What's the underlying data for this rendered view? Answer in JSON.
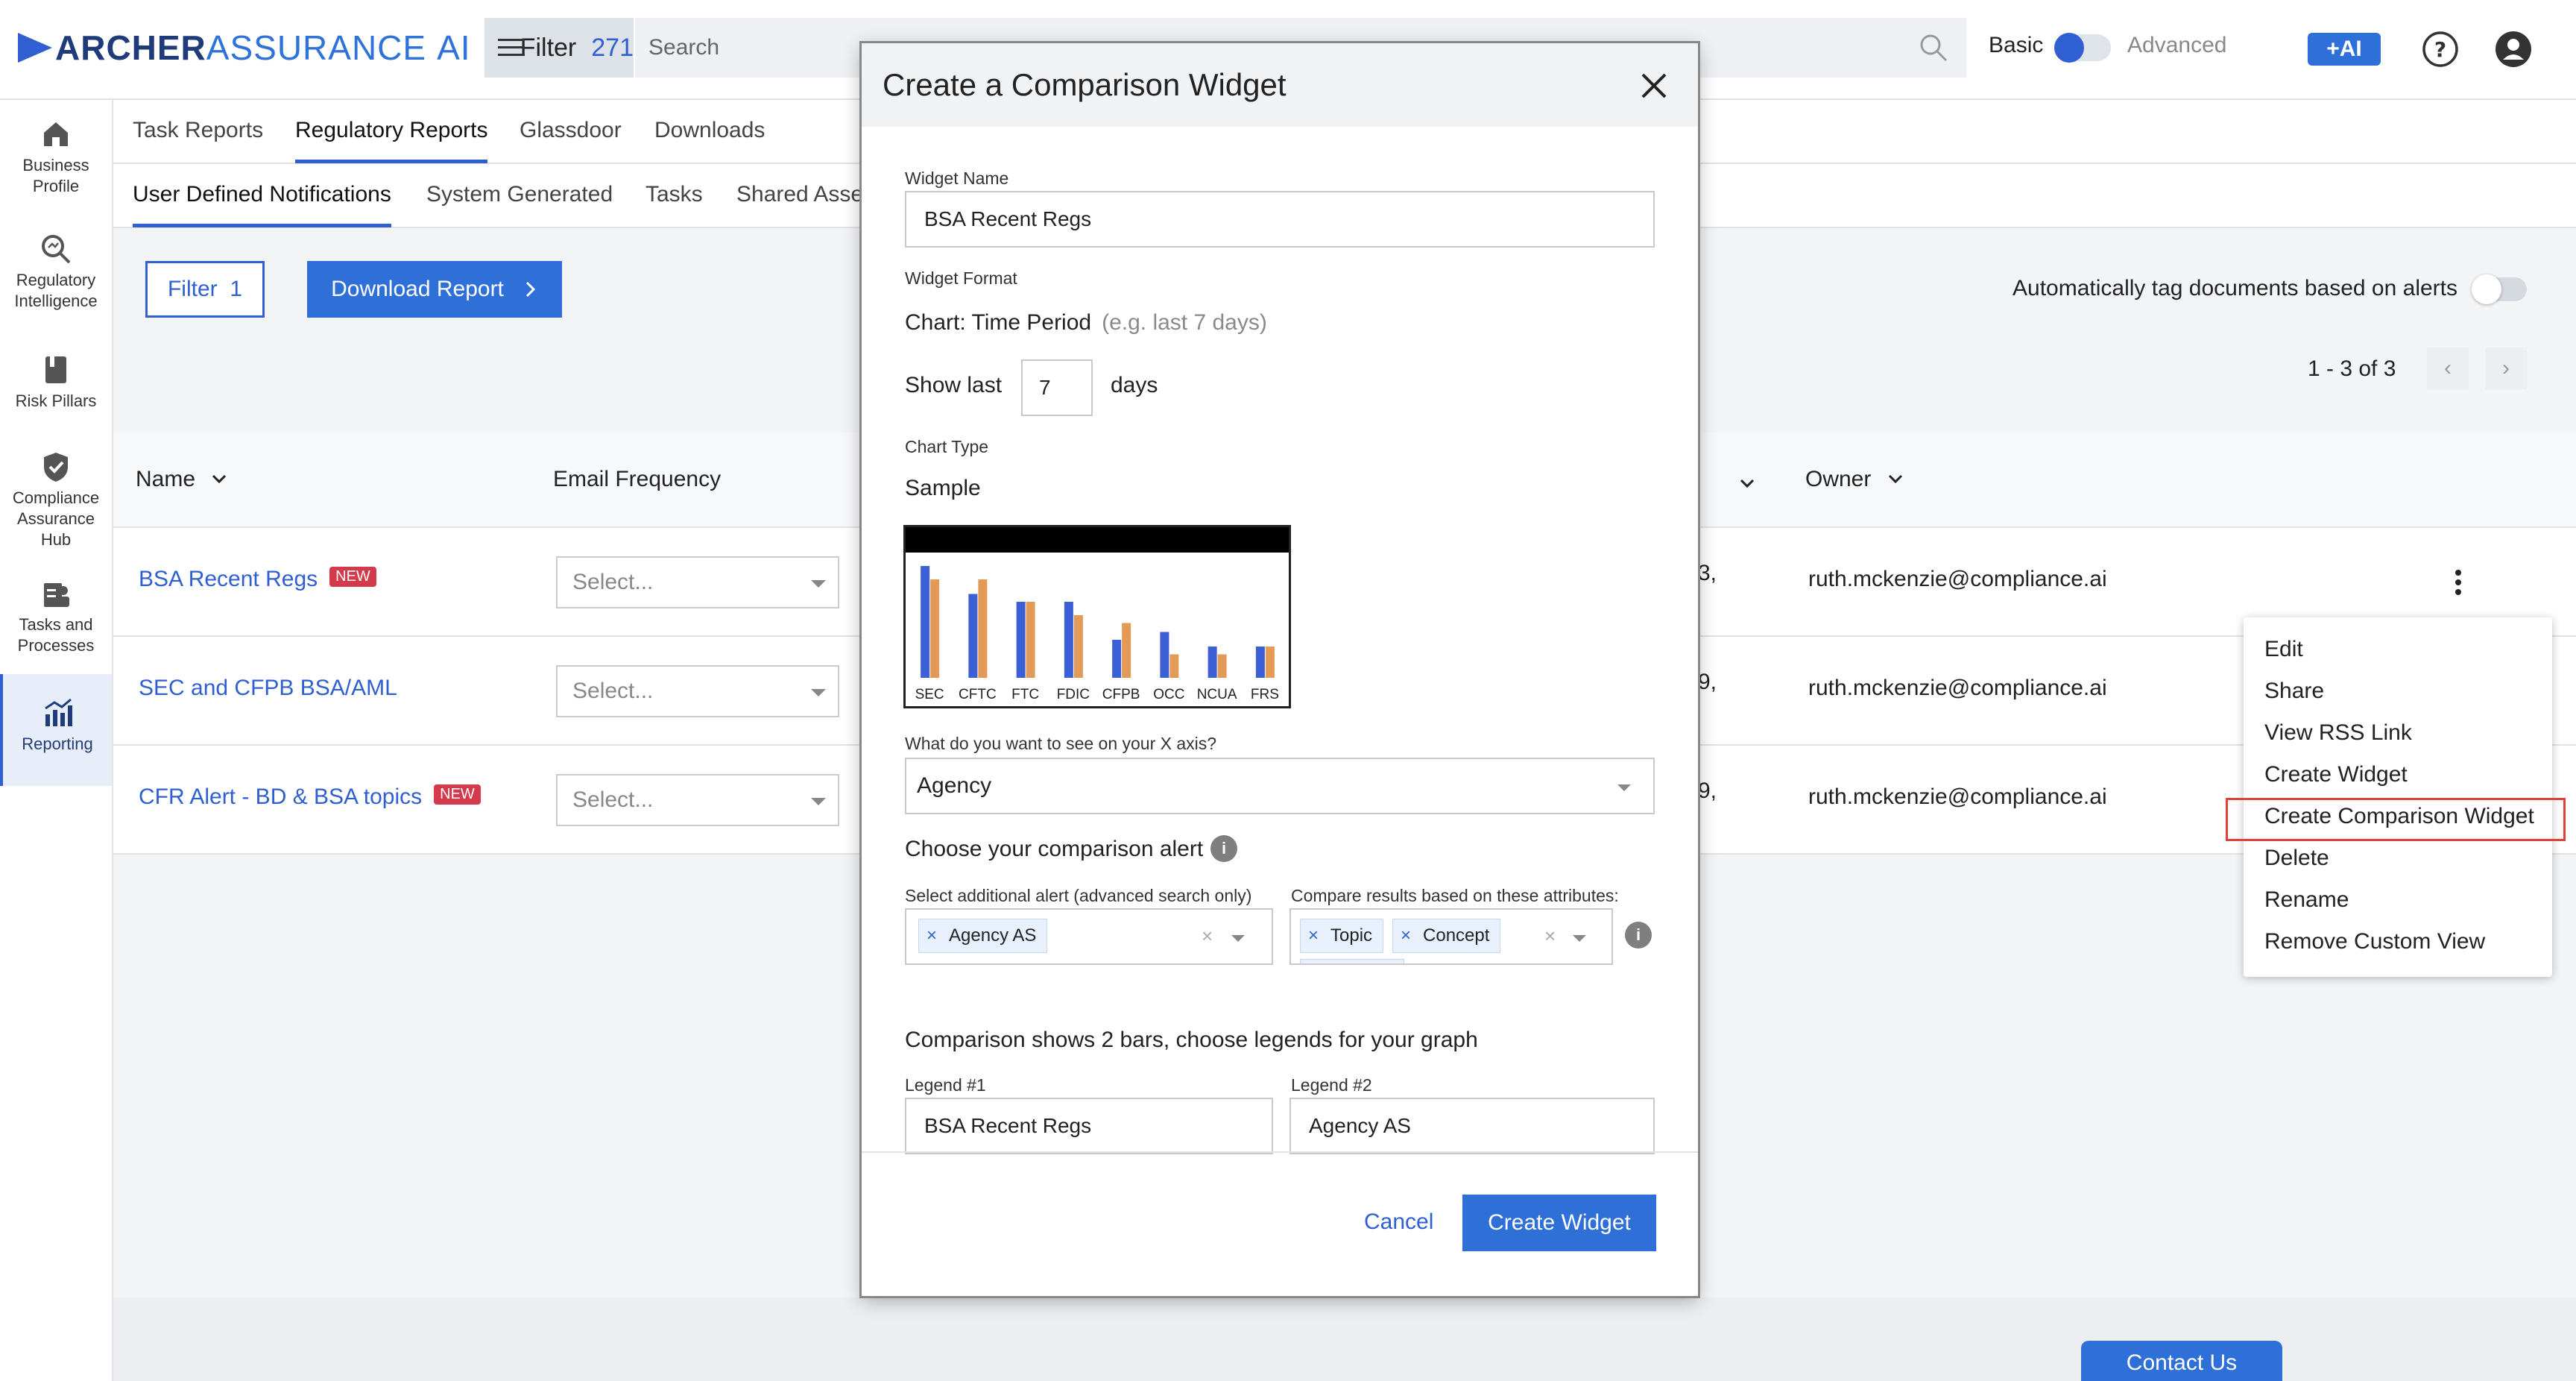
{
  "app": {
    "logo_part1": "ARCHER",
    "logo_part2": "ASSURANCE",
    "logo_part3": "AI",
    "filter_label": "Filter",
    "filter_count": "271",
    "search_placeholder": "Search",
    "mode_basic": "Basic",
    "mode_advanced": "Advanced",
    "ai_label": "+AI"
  },
  "sidebar": {
    "items": [
      {
        "label1": "Business",
        "label2": "Profile",
        "icon": "home-icon"
      },
      {
        "label1": "Regulatory",
        "label2": "Intelligence",
        "icon": "magnifier-icon"
      },
      {
        "label1": "Risk Pillars",
        "label2": "",
        "icon": "book-icon"
      },
      {
        "label1": "Compliance",
        "label2": "Assurance",
        "label3": "Hub",
        "icon": "shield-check-icon"
      },
      {
        "label1": "Tasks and",
        "label2": "Processes",
        "icon": "clipboard-user-icon"
      },
      {
        "label1": "Reporting",
        "label2": "",
        "icon": "chart-icon"
      }
    ]
  },
  "tabs_primary": [
    "Task Reports",
    "Regulatory Reports",
    "Glassdoor",
    "Downloads"
  ],
  "tabs_secondary": [
    "User Defined Notifications",
    "System Generated",
    "Tasks",
    "Shared Asse"
  ],
  "toolbar": {
    "filter_label": "Filter",
    "filter_count": "1",
    "download_label": "Download Report",
    "auto_tag_label": "Automatically tag documents based on alerts",
    "pager_text": "1 - 3 of 3"
  },
  "table": {
    "col_name": "Name",
    "col_email": "Email Frequency",
    "col_owner": "Owner",
    "rows": [
      {
        "name": "BSA Recent Regs",
        "new": "NEW",
        "select": "Select...",
        "trunc": "3,",
        "owner": "ruth.mckenzie@compliance.ai"
      },
      {
        "name": "SEC and CFPB BSA/AML",
        "new": "",
        "select": "Select...",
        "trunc": "9,",
        "owner": "ruth.mckenzie@compliance.ai"
      },
      {
        "name": "CFR Alert - BD & BSA topics",
        "new": "NEW",
        "select": "Select...",
        "trunc": "9,",
        "owner": "ruth.mckenzie@compliance.ai"
      }
    ]
  },
  "context_menu": [
    "Edit",
    "Share",
    "View RSS Link",
    "Create Widget",
    "Create Comparison Widget",
    "Delete",
    "Rename",
    "Remove Custom View"
  ],
  "modal": {
    "title": "Create a Comparison Widget",
    "widget_name_label": "Widget Name",
    "widget_name_value": "BSA Recent Regs",
    "widget_format_label": "Widget Format",
    "chart_time_period": "Chart: Time Period",
    "chart_time_hint": "(e.g. last 7 days)",
    "show_last_label": "Show last",
    "show_last_value": "7",
    "days_label": "days",
    "chart_type_label": "Chart Type",
    "sample_label": "Sample",
    "x_axis_label": "What do you want to see on your X axis?",
    "x_axis_value": "Agency",
    "comparison_alert_label": "Choose your comparison alert",
    "additional_alert_label": "Select additional alert (advanced search only)",
    "additional_alert_chip": "Agency AS",
    "compare_attr_label": "Compare results based on these attributes:",
    "compare_attr_chips": [
      "Topic",
      "Concept"
    ],
    "legend_intro": "Comparison shows 2 bars, choose legends for your graph",
    "legend1_label": "Legend #1",
    "legend1_value": "BSA Recent Regs",
    "legend2_label": "Legend #2",
    "legend2_value": "Agency AS",
    "cancel_label": "Cancel",
    "create_label": "Create Widget"
  },
  "contact_label": "Contact Us",
  "chart_data": {
    "type": "bar",
    "categories": [
      "SEC",
      "CFTC",
      "FTC",
      "FDIC",
      "CFPB",
      "OCC",
      "NCUA",
      "FRS"
    ],
    "series": [
      {
        "values": [
          10,
          7.5,
          6.8,
          6.8,
          3.4,
          4.1,
          2.8,
          2.8
        ]
      },
      {
        "values": [
          8.8,
          8.8,
          6.8,
          5.6,
          4.9,
          2.1,
          2.1,
          2.8
        ]
      }
    ],
    "colors": [
      "#3c5fd6",
      "#e39a56"
    ]
  }
}
